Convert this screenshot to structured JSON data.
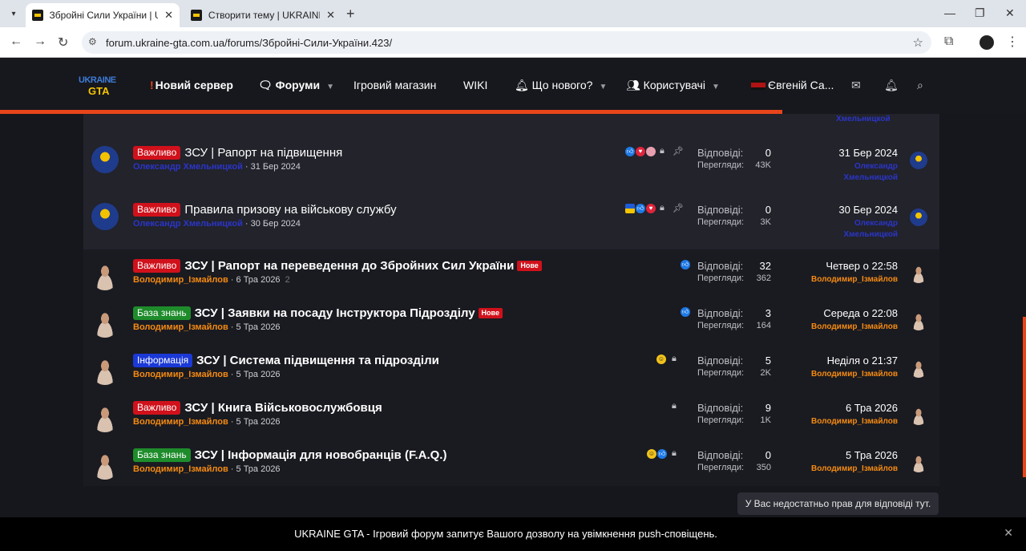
{
  "browser": {
    "tabs": [
      {
        "title": "Збройні Сили України | UKRAINE GTA",
        "active": true
      },
      {
        "title": "Створити тему | UKRAINE GTA",
        "active": false
      }
    ],
    "url": "forum.ukraine-gta.com.ua/forums/Збройні-Сили-України.423/"
  },
  "site": {
    "logo_top": "UKRAINE",
    "logo_bottom": "GTA",
    "nav": {
      "new_server": "Новий сервер",
      "forums": "Форуми",
      "shop": "Ігровий магазин",
      "wiki": "WIKI",
      "whats_new": "Що нового?",
      "users": "Користувачі",
      "username": "Євгеній Са..."
    },
    "colors": {
      "accent": "#e8451b",
      "prefix_red": "#d0111b",
      "prefix_green": "#1e8c2b",
      "prefix_blue": "#1b39d6",
      "author_blue": "#2b35c8",
      "author_orange": "#f58a12"
    }
  },
  "list": {
    "top_fragment": "Хмельницкой",
    "replies_label": "Відповіді:",
    "views_label": "Перегляди:",
    "threads": [
      {
        "prefix": "Важливо",
        "prefix_color": "red",
        "title": "ЗСУ | Рапорт на підвищення",
        "author": "Олександр Хмельницкой",
        "author_color": "blue",
        "date": "31 Бер 2024",
        "pages": "",
        "is_new": false,
        "new_label": "",
        "reactions": [
          "like",
          "love",
          "pink"
        ],
        "locked": true,
        "sticky": true,
        "replies": "0",
        "views": "43K",
        "last_date": "31 Бер 2024",
        "last_user": "Олександр Хмельницкой",
        "last_user_color": "blue",
        "avatar": "crest"
      },
      {
        "prefix": "Важливо",
        "prefix_color": "red",
        "title": "Правила призову на військову службу",
        "author": "Олександр Хмельницкой",
        "author_color": "blue",
        "date": "30 Бер 2024",
        "pages": "",
        "is_new": false,
        "new_label": "",
        "reactions": [
          "flag",
          "like",
          "love"
        ],
        "locked": true,
        "sticky": true,
        "replies": "0",
        "views": "3K",
        "last_date": "30 Бер 2024",
        "last_user": "Олександр Хмельницкой",
        "last_user_color": "blue",
        "avatar": "crest"
      },
      {
        "prefix": "Важливо",
        "prefix_color": "red",
        "title": "ЗСУ | Рапорт на переведення до Збройних Сил України",
        "author": "Володимир_Ізмайлов",
        "author_color": "orange",
        "date": "6 Тра 2026",
        "pages": "2",
        "is_new": true,
        "new_label": "Нове",
        "reactions": [
          "like"
        ],
        "locked": false,
        "sticky": false,
        "replies": "32",
        "views": "362",
        "last_date": "Четвер о 22:58",
        "last_user": "Володимир_Ізмайлов",
        "last_user_color": "orange",
        "avatar": "person"
      },
      {
        "prefix": "База знань",
        "prefix_color": "green",
        "title": "ЗСУ | Заявки на посаду Інструктора Підрозділу",
        "author": "Володимир_Ізмайлов",
        "author_color": "orange",
        "date": "5 Тра 2026",
        "pages": "",
        "is_new": true,
        "new_label": "Нове",
        "reactions": [
          "like"
        ],
        "locked": false,
        "sticky": false,
        "replies": "3",
        "views": "164",
        "last_date": "Середа о 22:08",
        "last_user": "Володимир_Ізмайлов",
        "last_user_color": "orange",
        "avatar": "person"
      },
      {
        "prefix": "Інформація",
        "prefix_color": "blue",
        "title": "ЗСУ | Система підвищення та підрозділи",
        "author": "Володимир_Ізмайлов",
        "author_color": "orange",
        "date": "5 Тра 2026",
        "pages": "",
        "is_new": false,
        "new_label": "",
        "reactions": [
          "haha"
        ],
        "locked": true,
        "sticky": false,
        "replies": "5",
        "views": "2K",
        "last_date": "Неділя о 21:37",
        "last_user": "Володимир_Ізмайлов",
        "last_user_color": "orange",
        "avatar": "person"
      },
      {
        "prefix": "Важливо",
        "prefix_color": "red",
        "title": "ЗСУ | Книга Військовослужбовця",
        "author": "Володимир_Ізмайлов",
        "author_color": "orange",
        "date": "5 Тра 2026",
        "pages": "",
        "is_new": false,
        "new_label": "",
        "reactions": [],
        "locked": true,
        "sticky": false,
        "replies": "9",
        "views": "1K",
        "last_date": "6 Тра 2026",
        "last_user": "Володимир_Ізмайлов",
        "last_user_color": "orange",
        "avatar": "person"
      },
      {
        "prefix": "База знань",
        "prefix_color": "green",
        "title": "ЗСУ | Інформація для новобранців (F.A.Q.)",
        "author": "Володимир_Ізмайлов",
        "author_color": "orange",
        "date": "5 Тра 2026",
        "pages": "",
        "is_new": false,
        "new_label": "",
        "reactions": [
          "haha",
          "like"
        ],
        "locked": true,
        "sticky": false,
        "replies": "0",
        "views": "350",
        "last_date": "5 Тра 2026",
        "last_user": "Володимир_Ізмайлов",
        "last_user_color": "orange",
        "avatar": "person"
      }
    ]
  },
  "no_permission": "У Вас недостатньо прав для відповіді тут.",
  "push_banner": "UKRAINE GTA - Ігровий форум запитує Вашого дозволу на увімкнення push-сповіщень."
}
